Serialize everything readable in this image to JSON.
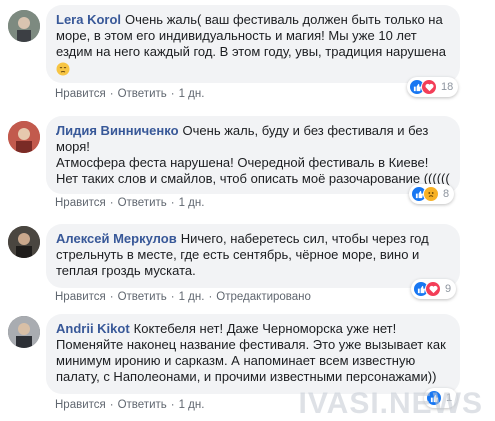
{
  "actions": {
    "like": "Нравится",
    "reply": "Ответить",
    "sep": "·"
  },
  "comments": [
    {
      "author": "Lera Korol",
      "text": "Очень жаль( ваш фестиваль должен быть только на море, в этом его индивидуальность и магия! Мы уже 10 лет ездим на него каждый год. В этом году, увы, традиция нарушена",
      "emoji": "pensive-face-emoji",
      "time": "1 дн.",
      "edited": "",
      "reactions": {
        "icons": [
          "like-icon",
          "love-icon"
        ],
        "count": "18"
      }
    },
    {
      "author": "Лидия Винниченко",
      "text1": "Очень жаль, буду и без фестиваля и без моря!",
      "text2": "Атмосфера феста нарушена! Очередной фестиваль в Киеве!Нет таких слов и смайлов, чтоб описать моё разочарование ((((((",
      "time": "1 дн.",
      "edited": "",
      "reactions": {
        "icons": [
          "like-icon",
          "sad-icon"
        ],
        "count": "8"
      }
    },
    {
      "author": "Алексей Меркулов",
      "text": "Ничего, наберетесь сил, чтобы через год стрельнуть в месте, где есть сентябрь, чёрное море, вино и теплая гроздь муската.",
      "time": "1 дн.",
      "edited": "Отредактировано",
      "reactions": {
        "icons": [
          "like-icon",
          "love-icon"
        ],
        "count": "9"
      }
    },
    {
      "author": "Andrii Kikot",
      "text": "Коктебеля нет! Даже Черноморска уже нет! Поменяйте наконец название фестиваля. Это уже вызывает как минимум иронию и сарказм. А напоминает всем известную палату, с Наполеонами, и прочими известными персонажами))",
      "time": "1 дн.",
      "edited": "",
      "reactions": {
        "icons": [
          "like-icon"
        ],
        "count": "1"
      }
    }
  ],
  "watermark": "IVASI.NEWS",
  "colors": {
    "author": "#385898",
    "bubble": "#f2f3f5",
    "meta": "#606770",
    "like": "#1877f2",
    "love": "#f33e58",
    "sad": "#f7b125"
  }
}
